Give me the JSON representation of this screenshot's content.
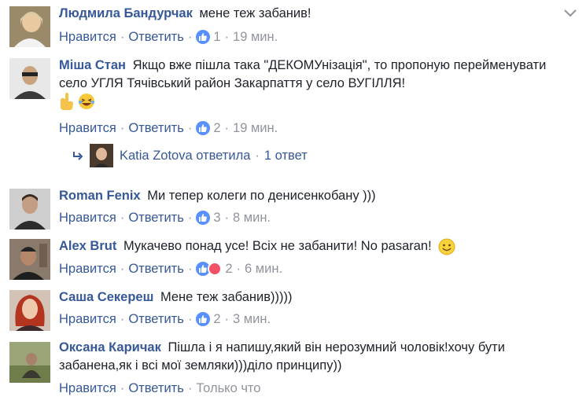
{
  "comments": [
    {
      "author": "Людмила Бандурчак",
      "text": "мене теж забанив!",
      "like_label": "Нравится",
      "reply_label": "Ответить",
      "reactions": "1",
      "time": "19 мин."
    },
    {
      "author": "Міша Стан",
      "text": "Якщо вже пішла така \"ДЕКОМУнізація\", то пропоную перейменувати село УГЛЯ Тячівський район Закарпаття у село ВУГІЛЛЯ!",
      "like_label": "Нравится",
      "reply_label": "Ответить",
      "reactions": "2",
      "time": "19 мин."
    },
    {
      "author": "Roman Fenix",
      "text": "Ми тепер колеги по денисенкобану )))",
      "like_label": "Нравится",
      "reply_label": "Ответить",
      "reactions": "3",
      "time": "8 мин."
    },
    {
      "author": "Alex Brut",
      "text": "Мукачево понад усе! Всіх не забанити! No pasaran!",
      "like_label": "Нравится",
      "reply_label": "Ответить",
      "reactions": "2",
      "time": "6 мин."
    },
    {
      "author": "Саша Секереш",
      "text": "Мене теж забанив)))))",
      "like_label": "Нравится",
      "reply_label": "Ответить",
      "reactions": "2",
      "time": "3 мин."
    },
    {
      "author": "Оксана Каричак",
      "text": "Пішла і я напишу,який він нерозумний чоловік!хочу бути забанена,як і всі мої земляки)))діло принципу))",
      "like_label": "Нравится",
      "reply_label": "Ответить",
      "time": "Только что"
    }
  ],
  "reply_summary": {
    "name": "Katia Zotova ответила",
    "count": "1 ответ"
  },
  "icons": {
    "menu": "chevron-down-icon",
    "like": "like-reaction-icon",
    "haha": "haha-reaction-icon",
    "love": "love-reaction-icon",
    "reply": "reply-arrow-icon"
  },
  "colors": {
    "author": "#365899",
    "meta": "#90949c",
    "like": "#5890ff",
    "love": "#f25268",
    "haha": "#f0ba15"
  }
}
